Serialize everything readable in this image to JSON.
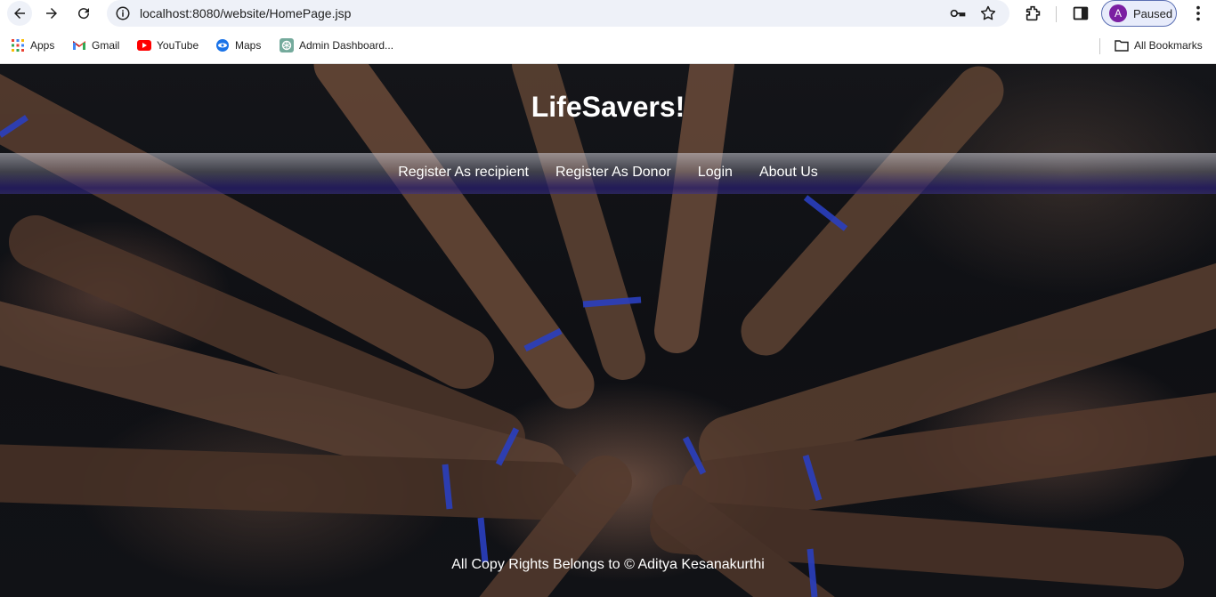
{
  "browser": {
    "url": "localhost:8080/website/HomePage.jsp",
    "profile_initial": "A",
    "profile_status": "Paused",
    "bookmarks": [
      {
        "label": "Apps",
        "icon": "apps-grid-icon"
      },
      {
        "label": "Gmail",
        "icon": "gmail-icon"
      },
      {
        "label": "YouTube",
        "icon": "youtube-icon"
      },
      {
        "label": "Maps",
        "icon": "maps-icon"
      },
      {
        "label": "Admin Dashboard...",
        "icon": "openai-icon"
      }
    ],
    "all_bookmarks": "All Bookmarks"
  },
  "site": {
    "title": "LifeSavers!",
    "nav": [
      {
        "label": "Register As recipient"
      },
      {
        "label": "Register As Donor"
      },
      {
        "label": "Login"
      },
      {
        "label": "About Us"
      }
    ],
    "footer": "All Copy Rights Belongs to © Aditya Kesanakurthi"
  },
  "colors": {
    "navbar_band": "#2a1f7a",
    "bracelet": "#2a3fbf",
    "profile_avatar": "#7b1fa2"
  }
}
